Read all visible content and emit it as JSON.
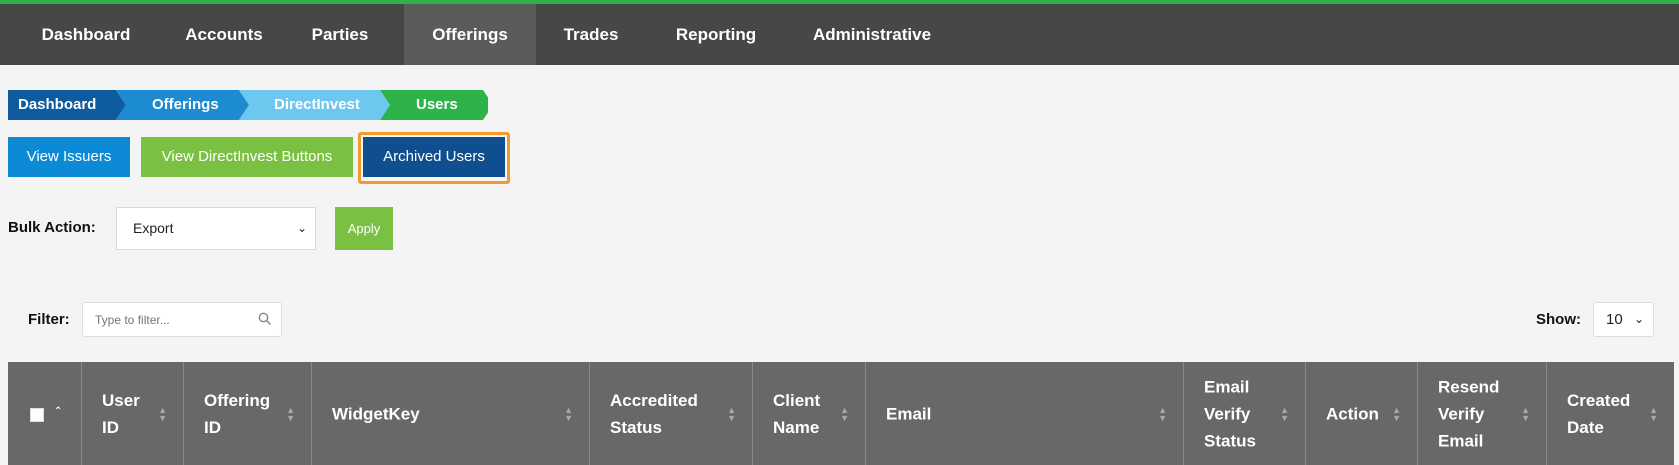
{
  "nav": {
    "items": [
      {
        "label": "Dashboard"
      },
      {
        "label": "Accounts"
      },
      {
        "label": "Parties"
      },
      {
        "label": "Offerings"
      },
      {
        "label": "Trades"
      },
      {
        "label": "Reporting"
      },
      {
        "label": "Administrative"
      }
    ],
    "active": "Offerings"
  },
  "breadcrumb": [
    {
      "label": "Dashboard",
      "color": "#0e5b9e"
    },
    {
      "label": "Offerings",
      "color": "#1c8bd1"
    },
    {
      "label": "DirectInvest",
      "color": "#6ec7ef"
    },
    {
      "label": "Users",
      "color": "#2db34a"
    }
  ],
  "actions": {
    "view_issuers": "View Issuers",
    "view_directinvest_buttons": "View DirectInvest Buttons",
    "archived_users": "Archived Users"
  },
  "bulk": {
    "label": "Bulk Action:",
    "selected": "Export",
    "apply": "Apply"
  },
  "filter": {
    "label": "Filter:",
    "placeholder": "Type to filter..."
  },
  "show": {
    "label": "Show:",
    "value": "10"
  },
  "table": {
    "columns": [
      {
        "label": "User\nID"
      },
      {
        "label": "Offering\nID"
      },
      {
        "label": "WidgetKey"
      },
      {
        "label": "Accredited\nStatus"
      },
      {
        "label": "Client\nName"
      },
      {
        "label": "Email"
      },
      {
        "label": "Email\nVerify\nStatus"
      },
      {
        "label": "Action"
      },
      {
        "label": "Resend\nVerify\nEmail"
      },
      {
        "label": "Created\nDate"
      }
    ]
  },
  "colors": {
    "accent_green": "#2db34a",
    "topbar": "#474747",
    "button_blue": "#0d8ad6",
    "button_green": "#7ac143",
    "button_dark_blue": "#0f4f8f",
    "highlight_orange": "#f39a2e",
    "table_header": "#686868"
  }
}
